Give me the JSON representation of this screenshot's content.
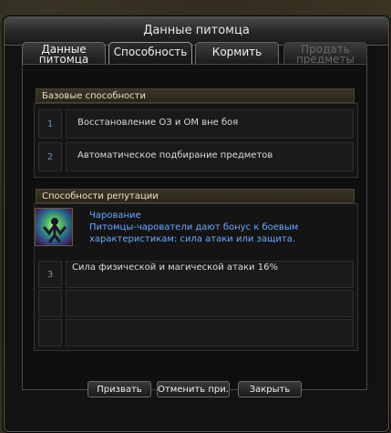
{
  "window": {
    "title": "Данные питомца"
  },
  "tabs": [
    {
      "label_line1": "Данные",
      "label_line2": "питомца"
    },
    {
      "label": "Способность"
    },
    {
      "label": "Кормить"
    },
    {
      "label_line1": "Продать",
      "label_line2": "предметы"
    }
  ],
  "basic": {
    "header": "Базовые способности",
    "rows": [
      {
        "num": "1",
        "text": "Восстановление ОЗ и ОМ вне боя"
      },
      {
        "num": "2",
        "text": "Автоматическое подбирание предметов"
      }
    ]
  },
  "reputation": {
    "header": "Способности репутации",
    "skill_name": "Чарование",
    "skill_desc": "Питомцы-чарователи дают бонус к боевым характеристикам: сила атаки или защита.",
    "rows": [
      {
        "num": "3",
        "text": "Сила физической и магической атаки 16%"
      }
    ]
  },
  "buttons": {
    "summon": "Призвать",
    "cancel": "Отменить при...",
    "close": "Закрыть"
  },
  "colors": {
    "accent_blue": "#6fa8ff",
    "title_text": "#e6e6e6"
  }
}
